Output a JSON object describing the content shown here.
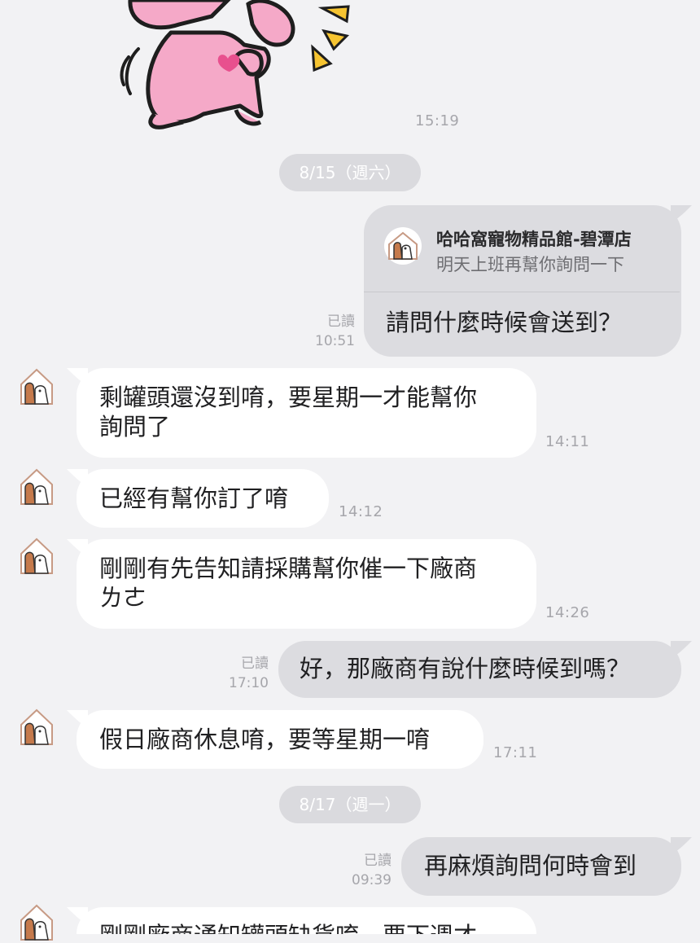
{
  "top_message": {
    "time": "15:19",
    "sticker": "pink-bunny-dancing-sticker"
  },
  "dates": {
    "d1": "8/15（週六）",
    "d2": "8/17（週一）"
  },
  "reply_message": {
    "quoted_sender": "哈哈窩寵物精品館-碧潭店",
    "quoted_text": "明天上班再幫你詢問一下",
    "text": "請問什麼時候會送到？",
    "read": "已讀",
    "time": "10:51"
  },
  "messages": [
    {
      "lines": [
        "剩罐頭還沒到唷，要星期一才能幫你",
        "詢問了"
      ],
      "time": "14:11"
    },
    {
      "lines": [
        "已經有幫你訂了唷"
      ],
      "time": "14:12"
    },
    {
      "lines": [
        "剛剛有先告知請採購幫你催一下廠商",
        "ㄌㄜ"
      ],
      "time": "14:26"
    },
    {
      "text": "好，那廠商有說什麼時候到嗎？",
      "read": "已讀",
      "time": "17:10"
    },
    {
      "lines": [
        "假日廠商休息唷，要等星期一唷"
      ],
      "time": "17:11"
    },
    {
      "text": "再麻煩詢問何時會到",
      "read": "已讀",
      "time": "09:39"
    },
    {
      "lines": [
        "剛剛廠商通知罐頭缺貨唷，要下週才"
      ]
    }
  ],
  "colors": {
    "background": "#f2f2f4",
    "incoming": "#ffffff",
    "outgoing": "#dcdce0",
    "meta": "#a6a6ab",
    "sticker_pink": "#f5a9c8"
  },
  "icons": {
    "avatar": "store-logo-icon"
  }
}
